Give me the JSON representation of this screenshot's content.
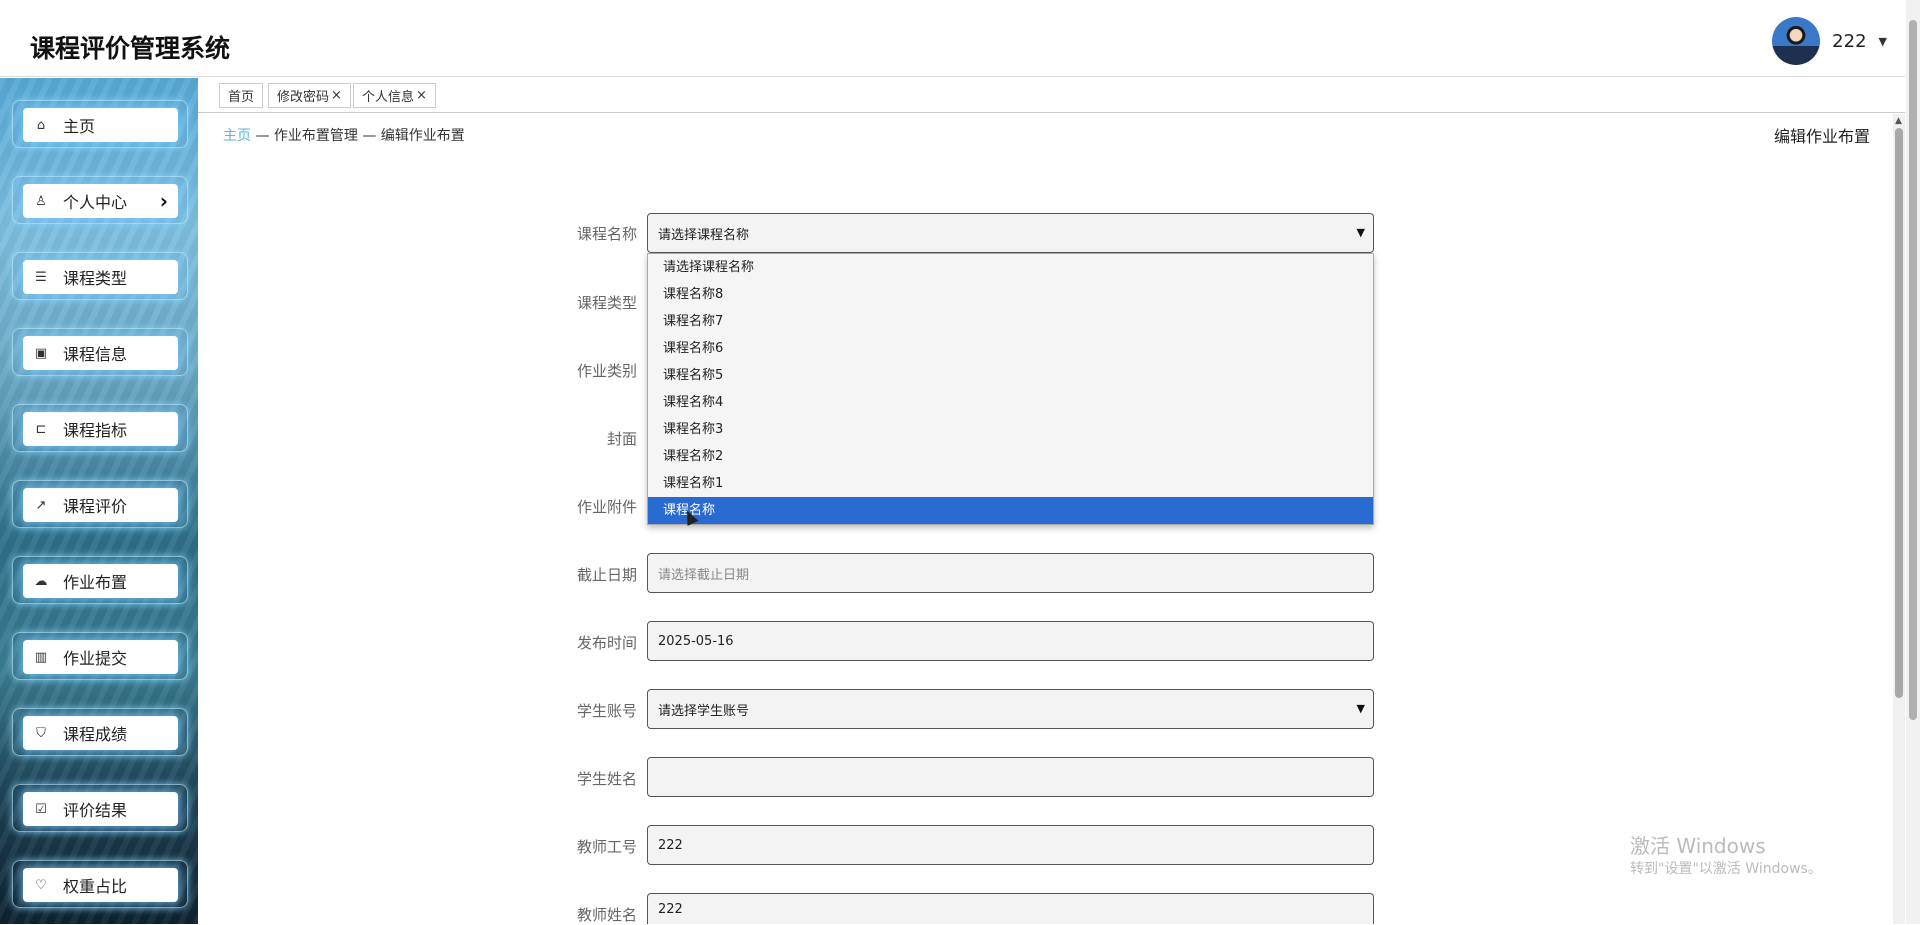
{
  "app": {
    "title": "课程评价管理系统"
  },
  "user": {
    "name": "222"
  },
  "sidebar": {
    "items": [
      {
        "label": "主页",
        "icon": "home-icon",
        "glyph": "⌂"
      },
      {
        "label": "个人中心",
        "icon": "user-icon",
        "glyph": "♙",
        "arrow": "›"
      },
      {
        "label": "课程类型",
        "icon": "list-icon",
        "glyph": "☰"
      },
      {
        "label": "课程信息",
        "icon": "document-icon",
        "glyph": "▣"
      },
      {
        "label": "课程指标",
        "icon": "login-icon",
        "glyph": "⊏"
      },
      {
        "label": "课程评价",
        "icon": "share-icon",
        "glyph": "↗"
      },
      {
        "label": "作业布置",
        "icon": "cloud-icon",
        "glyph": "☁"
      },
      {
        "label": "作业提交",
        "icon": "bar-chart-icon",
        "glyph": "▥"
      },
      {
        "label": "课程成绩",
        "icon": "shield-icon",
        "glyph": "⛉"
      },
      {
        "label": "评价结果",
        "icon": "checklist-icon",
        "glyph": "☑"
      },
      {
        "label": "权重占比",
        "icon": "heart-icon",
        "glyph": "♡"
      }
    ]
  },
  "tabs": [
    {
      "label": "首页",
      "closable": false
    },
    {
      "label": "修改密码",
      "closable": true
    },
    {
      "label": "个人信息",
      "closable": true
    }
  ],
  "close_glyph": "×",
  "breadcrumb": {
    "home": "主页",
    "rest": " — 作业布置管理 — 编辑作业布置"
  },
  "page_title": "编辑作业布置",
  "form": {
    "labels": {
      "course_name": "课程名称",
      "course_type": "课程类型",
      "assignment_category": "作业类别",
      "cover": "封面",
      "attachment": "作业附件",
      "deadline": "截止日期",
      "publish_time": "发布时间",
      "student_account": "学生账号",
      "student_name": "学生姓名",
      "teacher_id": "教师工号",
      "teacher_name": "教师姓名"
    },
    "course_name_value": "请选择课程名称",
    "deadline_placeholder": "请选择截止日期",
    "publish_time_value": "2025-05-16",
    "student_account_value": "请选择学生账号",
    "student_name_value": "",
    "teacher_id_value": "222",
    "teacher_name_value": "222"
  },
  "dropdown": {
    "options": [
      "请选择课程名称",
      "课程名称8",
      "课程名称7",
      "课程名称6",
      "课程名称5",
      "课程名称4",
      "课程名称3",
      "课程名称2",
      "课程名称1",
      "课程名称"
    ],
    "selected_index": 9
  },
  "watermark": {
    "line1": "激活 Windows",
    "line2": "转到\"设置\"以激活 Windows。"
  },
  "colors": {
    "accent": "#5cb4e0",
    "selected": "#2a6bd1"
  }
}
